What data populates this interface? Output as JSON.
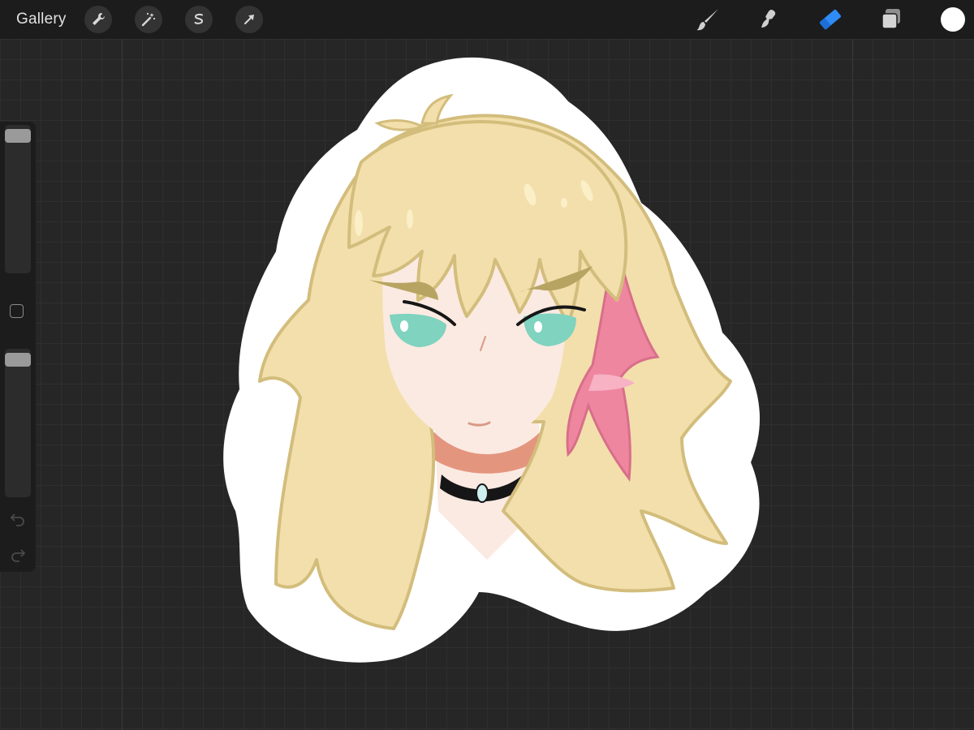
{
  "topbar": {
    "gallery_label": "Gallery",
    "tools_left": [
      {
        "name": "actions",
        "icon": "wrench-icon"
      },
      {
        "name": "adjustments",
        "icon": "magic-wand-icon"
      },
      {
        "name": "selection",
        "icon": "selection-s-icon"
      },
      {
        "name": "transform",
        "icon": "transform-arrow-icon"
      }
    ],
    "tools_right": [
      {
        "name": "brush",
        "icon": "brush-icon",
        "active": false
      },
      {
        "name": "smudge",
        "icon": "smudge-icon",
        "active": false
      },
      {
        "name": "eraser",
        "icon": "eraser-icon",
        "active": true
      },
      {
        "name": "layers",
        "icon": "layers-icon",
        "active": false
      },
      {
        "name": "color",
        "icon": "color-swatch",
        "value": "#ffffff"
      }
    ]
  },
  "sidebar": {
    "brush_size_level": 0.03,
    "opacity_level": 0.03
  },
  "colors": {
    "accent": "#2f8bf5",
    "hair": "#f3dfab",
    "hair_outline": "#d3bd7c",
    "skin": "#fbeae2",
    "eyes": "#7fd3bf",
    "pink_streak": "#ef86a0",
    "sticker_border": "#ffffff"
  }
}
